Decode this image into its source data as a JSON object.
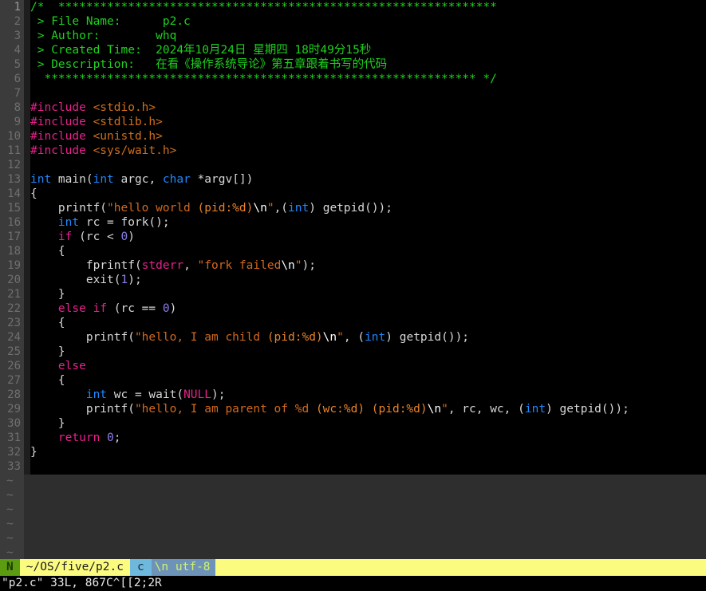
{
  "app": {
    "name": "vim-terminal",
    "filetype_label": "c"
  },
  "colors": {
    "background": "#000000",
    "empty_background": "#2e2e2e",
    "gutter": "#3b3b3b",
    "comment_green": "#1fd21f",
    "preprocessor_pink": "#e8218c",
    "header_orange": "#d06f1a",
    "keyword_blue": "#1e88ff",
    "string_orange": "#d3691e",
    "number_purple": "#8a7fe8",
    "status_yellow": "#fbfb80",
    "status_green": "#5c9c10",
    "status_blue": "#6fb8dd",
    "status_encoding_blue": "#6d94b8"
  },
  "editor": {
    "total_lines": 33,
    "current_line": 1,
    "lines": [
      {
        "n": "1",
        "tokens": [
          {
            "t": "/*  ***************************************************************",
            "c": "c-comment"
          }
        ]
      },
      {
        "n": "2",
        "tokens": [
          {
            "t": " > File Name:      p2.c",
            "c": "c-comment"
          }
        ]
      },
      {
        "n": "3",
        "tokens": [
          {
            "t": " > Author:        whq",
            "c": "c-comment"
          }
        ]
      },
      {
        "n": "4",
        "tokens": [
          {
            "t": " > Created Time:  2024年10月24日 星期四 18时49分15秒",
            "c": "c-comment"
          }
        ]
      },
      {
        "n": "5",
        "tokens": [
          {
            "t": " > Description:   在看《操作系统导论》第五章跟着书写的代码",
            "c": "c-comment"
          }
        ]
      },
      {
        "n": "6",
        "tokens": [
          {
            "t": "  ************************************************************** */",
            "c": "c-comment"
          }
        ]
      },
      {
        "n": "7",
        "tokens": []
      },
      {
        "n": "8",
        "tokens": [
          {
            "t": "#include",
            "c": "c-pre"
          },
          {
            "t": " ",
            "c": "c-plain"
          },
          {
            "t": "<stdio.h>",
            "c": "c-header"
          }
        ]
      },
      {
        "n": "9",
        "tokens": [
          {
            "t": "#include",
            "c": "c-pre"
          },
          {
            "t": " ",
            "c": "c-plain"
          },
          {
            "t": "<stdlib.h>",
            "c": "c-header"
          }
        ]
      },
      {
        "n": "10",
        "tokens": [
          {
            "t": "#include",
            "c": "c-pre"
          },
          {
            "t": " ",
            "c": "c-plain"
          },
          {
            "t": "<unistd.h>",
            "c": "c-header"
          }
        ]
      },
      {
        "n": "11",
        "tokens": [
          {
            "t": "#include",
            "c": "c-pre"
          },
          {
            "t": " ",
            "c": "c-plain"
          },
          {
            "t": "<sys/wait.h>",
            "c": "c-header"
          }
        ]
      },
      {
        "n": "12",
        "tokens": []
      },
      {
        "n": "13",
        "tokens": [
          {
            "t": "int",
            "c": "c-kw"
          },
          {
            "t": " main(",
            "c": "c-plain"
          },
          {
            "t": "int",
            "c": "c-kw"
          },
          {
            "t": " argc, ",
            "c": "c-plain"
          },
          {
            "t": "char",
            "c": "c-kw"
          },
          {
            "t": " *argv[])",
            "c": "c-plain"
          }
        ]
      },
      {
        "n": "14",
        "tokens": [
          {
            "t": "{",
            "c": "c-plain"
          }
        ]
      },
      {
        "n": "15",
        "tokens": [
          {
            "t": "    printf(",
            "c": "c-plain"
          },
          {
            "t": "\"hello world ",
            "c": "c-str"
          },
          {
            "t": "(pid:%d)",
            "c": "c-strbright"
          },
          {
            "t": "\\n",
            "c": "c-esc"
          },
          {
            "t": "\"",
            "c": "c-str"
          },
          {
            "t": ",(",
            "c": "c-plain"
          },
          {
            "t": "int",
            "c": "c-kw"
          },
          {
            "t": ") getpid());",
            "c": "c-plain"
          }
        ]
      },
      {
        "n": "16",
        "tokens": [
          {
            "t": "    ",
            "c": "c-plain"
          },
          {
            "t": "int",
            "c": "c-kw"
          },
          {
            "t": " rc = fork();",
            "c": "c-plain"
          }
        ]
      },
      {
        "n": "17",
        "tokens": [
          {
            "t": "    ",
            "c": "c-plain"
          },
          {
            "t": "if",
            "c": "c-stmt"
          },
          {
            "t": " (rc < ",
            "c": "c-plain"
          },
          {
            "t": "0",
            "c": "c-num"
          },
          {
            "t": ")",
            "c": "c-plain"
          }
        ]
      },
      {
        "n": "18",
        "tokens": [
          {
            "t": "    {",
            "c": "c-plain"
          }
        ]
      },
      {
        "n": "19",
        "tokens": [
          {
            "t": "        fprintf(",
            "c": "c-plain"
          },
          {
            "t": "stderr",
            "c": "c-const"
          },
          {
            "t": ", ",
            "c": "c-plain"
          },
          {
            "t": "\"fork failed",
            "c": "c-str"
          },
          {
            "t": "\\n",
            "c": "c-esc"
          },
          {
            "t": "\"",
            "c": "c-str"
          },
          {
            "t": ");",
            "c": "c-plain"
          }
        ]
      },
      {
        "n": "20",
        "tokens": [
          {
            "t": "        exit(",
            "c": "c-plain"
          },
          {
            "t": "1",
            "c": "c-num"
          },
          {
            "t": ");",
            "c": "c-plain"
          }
        ]
      },
      {
        "n": "21",
        "tokens": [
          {
            "t": "    }",
            "c": "c-plain"
          }
        ]
      },
      {
        "n": "22",
        "tokens": [
          {
            "t": "    ",
            "c": "c-plain"
          },
          {
            "t": "else if",
            "c": "c-stmt"
          },
          {
            "t": " (rc == ",
            "c": "c-plain"
          },
          {
            "t": "0",
            "c": "c-num"
          },
          {
            "t": ")",
            "c": "c-plain"
          }
        ]
      },
      {
        "n": "23",
        "tokens": [
          {
            "t": "    {",
            "c": "c-plain"
          }
        ]
      },
      {
        "n": "24",
        "tokens": [
          {
            "t": "        printf(",
            "c": "c-plain"
          },
          {
            "t": "\"hello, I am child ",
            "c": "c-str"
          },
          {
            "t": "(pid:%d)",
            "c": "c-strbright"
          },
          {
            "t": "\\n",
            "c": "c-esc"
          },
          {
            "t": "\"",
            "c": "c-str"
          },
          {
            "t": ", (",
            "c": "c-plain"
          },
          {
            "t": "int",
            "c": "c-kw"
          },
          {
            "t": ") getpid());",
            "c": "c-plain"
          }
        ]
      },
      {
        "n": "25",
        "tokens": [
          {
            "t": "    }",
            "c": "c-plain"
          }
        ]
      },
      {
        "n": "26",
        "tokens": [
          {
            "t": "    ",
            "c": "c-plain"
          },
          {
            "t": "else",
            "c": "c-stmt"
          }
        ]
      },
      {
        "n": "27",
        "tokens": [
          {
            "t": "    {",
            "c": "c-plain"
          }
        ]
      },
      {
        "n": "28",
        "tokens": [
          {
            "t": "        ",
            "c": "c-plain"
          },
          {
            "t": "int",
            "c": "c-kw"
          },
          {
            "t": " wc = wait(",
            "c": "c-plain"
          },
          {
            "t": "NULL",
            "c": "c-const"
          },
          {
            "t": ");",
            "c": "c-plain"
          }
        ]
      },
      {
        "n": "29",
        "tokens": [
          {
            "t": "        printf(",
            "c": "c-plain"
          },
          {
            "t": "\"hello, I am parent of %d ",
            "c": "c-str"
          },
          {
            "t": "(wc:%d)",
            "c": "c-strbright"
          },
          {
            "t": " ",
            "c": "c-str"
          },
          {
            "t": "(pid:%d)",
            "c": "c-strbright"
          },
          {
            "t": "\\n",
            "c": "c-esc"
          },
          {
            "t": "\"",
            "c": "c-str"
          },
          {
            "t": ", rc, wc, (",
            "c": "c-plain"
          },
          {
            "t": "int",
            "c": "c-kw"
          },
          {
            "t": ") getpid());",
            "c": "c-plain"
          }
        ]
      },
      {
        "n": "30",
        "tokens": [
          {
            "t": "    }",
            "c": "c-plain"
          }
        ]
      },
      {
        "n": "31",
        "tokens": [
          {
            "t": "    ",
            "c": "c-plain"
          },
          {
            "t": "return",
            "c": "c-stmt"
          },
          {
            "t": " ",
            "c": "c-plain"
          },
          {
            "t": "0",
            "c": "c-num"
          },
          {
            "t": ";",
            "c": "c-plain"
          }
        ]
      },
      {
        "n": "32",
        "tokens": [
          {
            "t": "}",
            "c": "c-plain"
          }
        ]
      },
      {
        "n": "33",
        "tokens": []
      }
    ],
    "empty_marker": "~",
    "empty_marker_count": 6
  },
  "statusline": {
    "mode": "N",
    "filepath": "~/OS/five/p2.c",
    "filetype": "c",
    "fileformat_encoding": "\\n utf-8"
  },
  "cmdline": {
    "message": "\"p2.c\" 33L, 867C^[[2;2R"
  }
}
